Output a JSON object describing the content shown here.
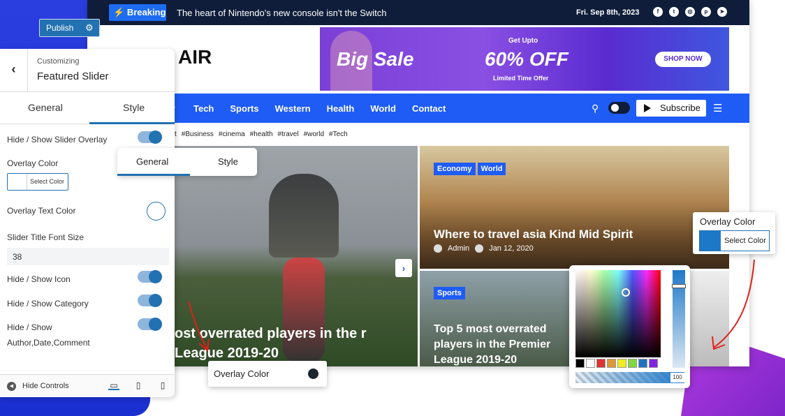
{
  "site": {
    "breaking_label": "Breaking",
    "breaking_text": "The heart of Nintendo's new console isn't the Switch",
    "date": "Fri. Sep 8th, 2023",
    "social_icons": [
      "facebook-icon",
      "twitter-icon",
      "instagram-icon",
      "pinterest-icon",
      "telegram-icon"
    ],
    "logo_text": "AIR",
    "banner": {
      "big_sale": "Big Sale",
      "get_upto": "Get Upto",
      "off": "60% OFF",
      "limited": "Limited Time Offer",
      "shop_now": "SHOP NOW"
    },
    "nav": [
      "Tech",
      "Sports",
      "Western",
      "Health",
      "World",
      "Contact"
    ],
    "subscribe": "Subscribe",
    "tags": [
      "t",
      "#Business",
      "#cinema",
      "#health",
      "#travel",
      "#world",
      "#Tech"
    ],
    "hero_title": "ost overrated players in the r League 2019-20",
    "card1": {
      "tags": [
        "Economy",
        "World"
      ],
      "title": "Where to travel asia Kind Mid Spirit",
      "author": "Admin",
      "date": "Jan 12, 2020"
    },
    "card2": {
      "tags": [
        "Sports"
      ],
      "title": "Top 5 most overrated players in the Premier League 2019-20"
    }
  },
  "publish": {
    "label": "Publish"
  },
  "panel": {
    "subtitle": "Customizing",
    "title": "Featured Slider",
    "tab_general": "General",
    "tab_style": "Style",
    "hide_show_overlay": "Hide / Show Slider Overlay",
    "overlay_color": "Overlay Color",
    "select_color": "Select Color",
    "overlay_text_color": "Overlay Text Color",
    "slider_title_font_size": "Slider Title Font Size",
    "font_size_value": "38",
    "hide_show_icon": "Hide / Show Icon",
    "hide_show_category": "Hide / Show Category",
    "hide_show_meta_1": "Hide / Show",
    "hide_show_meta_2": "Author,Date,Comment",
    "hide_controls": "Hide Controls"
  },
  "float_tabs": {
    "general": "General",
    "style": "Style"
  },
  "overlay_pill": {
    "label": "Overlay Color"
  },
  "picker": {
    "alpha_value": "100",
    "swatches": [
      "#000000",
      "#ffffff",
      "#dd3333",
      "#dd9933",
      "#eeee22",
      "#81d742",
      "#1e73be",
      "#8224e3"
    ]
  },
  "overlay_right": {
    "label": "Overlay Color",
    "select_color": "Select Color"
  }
}
